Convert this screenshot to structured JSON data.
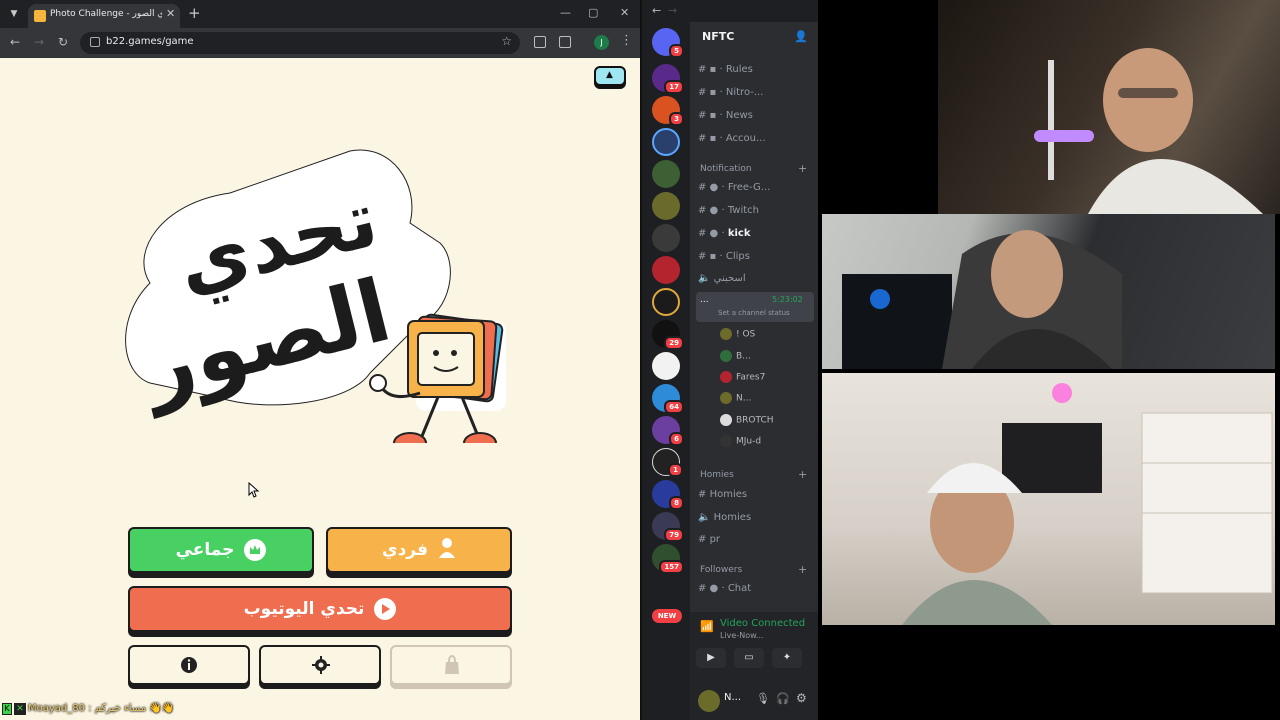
{
  "browser": {
    "tab_title": "Photo Challenge - تحدي الصور",
    "url": "b22.games/game",
    "profile_initial": "J",
    "new_tab": "+"
  },
  "game": {
    "logo_text_line1": "تحدي",
    "logo_text_line2": "الصور",
    "buttons": {
      "group": "جماعي",
      "solo": "فردي",
      "youtube": "تحدي اليوتيوب"
    },
    "accent_colors": {
      "group": "#49d063",
      "solo": "#f8b24a",
      "youtube": "#ee6e4f",
      "page_bg": "#fbf5e4"
    }
  },
  "stream_chat": {
    "message": "Moayad_80 : مساء خيركم 👋👋"
  },
  "discord": {
    "server_name": "NFTC",
    "server_badges": [
      "5",
      "17",
      "3",
      "29",
      "64",
      "6",
      "1",
      "8",
      "79",
      "157"
    ],
    "new_label": "NEW",
    "channels_top": [
      {
        "name": "Rules"
      },
      {
        "name": "Nitro-..."
      },
      {
        "name": "News"
      },
      {
        "name": "Accou..."
      }
    ],
    "category_notification": "Notification",
    "channels_notification": [
      {
        "name": "Free-G..."
      },
      {
        "name": "Twitch"
      },
      {
        "name": "kick"
      },
      {
        "name": "Clips"
      }
    ],
    "voice_room_label": "اسحبني",
    "voice_active": {
      "name": "...",
      "time": "5:23:02",
      "status": "Set a channel status"
    },
    "voice_users": [
      "! OS",
      "B...",
      "Fares7",
      "N...",
      "BROTCH",
      "MJu-d"
    ],
    "category_homies": "Homies",
    "channels_homies": [
      "Homies",
      "Homies",
      "pr"
    ],
    "category_followers": "Followers",
    "channels_followers": [
      "Chat"
    ],
    "vc_panel": {
      "title": "Video Connected",
      "subtitle": "Live-Now..."
    },
    "user_panel": {
      "name": "N..."
    }
  }
}
